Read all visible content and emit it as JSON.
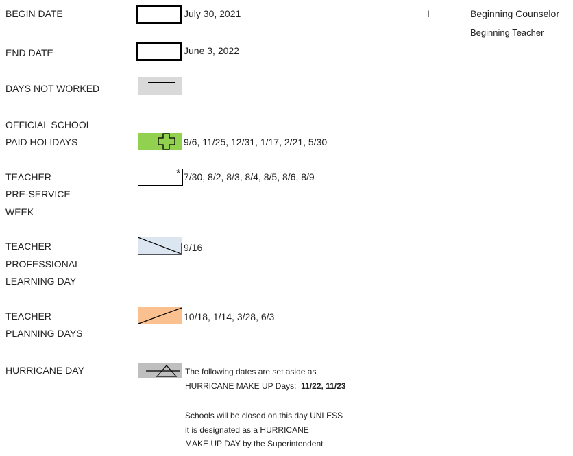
{
  "legend": {
    "begin_date": {
      "label": "BEGIN DATE",
      "value": "July 30, 2021"
    },
    "end_date": {
      "label": "END DATE",
      "value": "June 3, 2022"
    },
    "days_not_worked": {
      "label": "DAYS NOT WORKED"
    },
    "holidays": {
      "label_line1": "OFFICIAL SCHOOL",
      "label_line2": "PAID HOLIDAYS",
      "value": "9/6, 11/25, 12/31, 1/17, 2/21, 5/30",
      "color": "#92d050"
    },
    "pre_service": {
      "label_line1": "TEACHER",
      "label_line2": "PRE-SERVICE",
      "label_line3": "WEEK",
      "marker": "*",
      "value": "7/30, 8/2, 8/3, 8/4, 8/5, 8/6, 8/9"
    },
    "professional_learning": {
      "label_line1": "TEACHER",
      "label_line2": "PROFESSIONAL",
      "label_line3": "LEARNING DAY",
      "value": "9/16",
      "color": "#dce6f1"
    },
    "planning": {
      "label_line1": "TEACHER",
      "label_line2": "PLANNING DAYS",
      "value": "10/18, 1/14, 3/28, 6/3",
      "color": "#fac090"
    },
    "hurricane": {
      "label": "HURRICANE DAY",
      "note_line1": "The following dates are set aside as",
      "note_line2_prefix": "HURRICANE MAKE UP Days:",
      "note_line2_dates": "11/22, 11/23",
      "closed_line1": "Schools will be closed on this day UNLESS",
      "closed_line2": "it is designated as a HURRICANE",
      "closed_line3": "MAKE UP DAY by the Superintendent",
      "color": "#bfbfbf"
    }
  },
  "right_panel": {
    "marker": "I",
    "line1": "Beginning Counselor",
    "line2": "Beginning Teacher"
  },
  "colors": {
    "days_not_worked_fill": "#d9d9d9"
  }
}
